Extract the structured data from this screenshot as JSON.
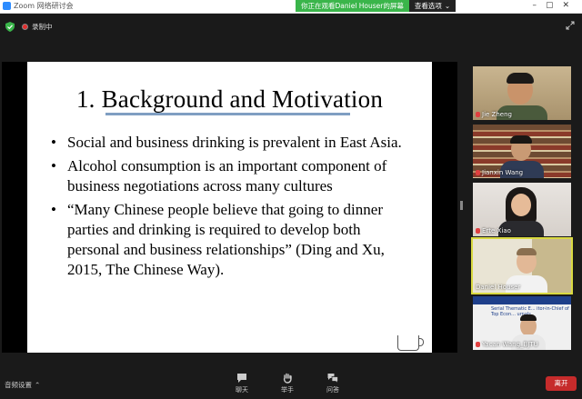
{
  "window": {
    "title": "Zoom 网络研讨会"
  },
  "share_banner": {
    "text": "你正在观看Daniel Houser的屏幕",
    "view_options": "查看选项"
  },
  "top": {
    "recording_label": "录制中"
  },
  "slide": {
    "title": "1. Background and Motivation",
    "bullets": [
      "Social and business drinking is prevalent in East Asia.",
      "Alcohol consumption is an important component of business negotiations across many cultures",
      "“Many Chinese people believe that going to dinner parties and drinking is required to develop both personal and business relationships” (Ding and Xu, 2015, The Chinese Way)."
    ]
  },
  "participants": [
    {
      "name": "Jie Zheng",
      "muted": true,
      "active": false
    },
    {
      "name": "Jianxin Wang",
      "muted": true,
      "active": false
    },
    {
      "name": "Erte Xiao",
      "muted": true,
      "active": false
    },
    {
      "name": "Daniel Houser",
      "muted": false,
      "active": true
    },
    {
      "name": "Yacan Wang_BJTU",
      "muted": true,
      "active": false,
      "screen_text": "Serial Thematic E... itor-in-Chief of Top Econ... urnals"
    }
  ],
  "bottom": {
    "audio_settings": "音频设置",
    "chat": "聊天",
    "raise_hand": "举手",
    "qa": "问答",
    "leave": "离开"
  },
  "colors": {
    "share_green": "#3ab54a",
    "leave_red": "#c62b2b",
    "active_outline": "#d9d941",
    "title_rule": "#7f9ec2"
  }
}
